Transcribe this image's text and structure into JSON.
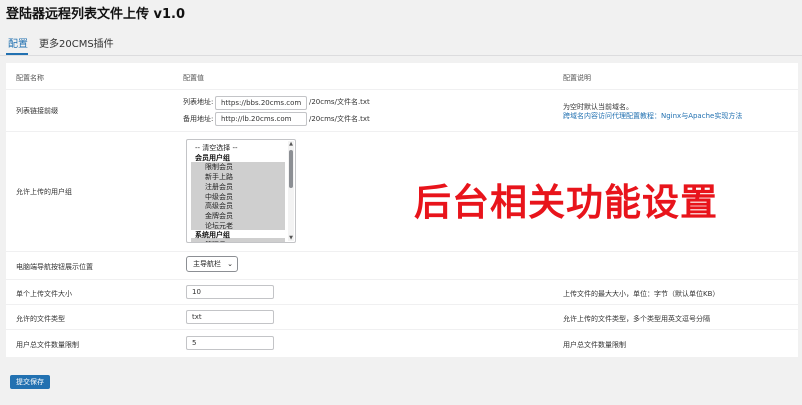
{
  "page": {
    "title": "登陆器远程列表文件上传 v1.0",
    "tabs": [
      {
        "label": "配置"
      },
      {
        "label": "更多20CMS插件"
      }
    ]
  },
  "table": {
    "headers": {
      "name": "配置名称",
      "value": "配置值",
      "desc": "配置说明"
    },
    "rows": {
      "prefix": {
        "label": "列表链接前缀",
        "list_addr_label": "列表地址:",
        "list_addr_value": "https://bbs.20cms.com",
        "list_addr_suffix": "/20cms/文件名.txt",
        "backup_addr_label": "备用地址:",
        "backup_addr_value": "http://lb.20cms.com",
        "backup_addr_suffix": "/20cms/文件名.txt",
        "desc_line1": "为空时默认当前域名。",
        "desc_link": "跨域名内容访问代理配置教程：Nginx与Apache实现方法"
      },
      "groups": {
        "label": "允许上传的用户组",
        "options": [
          {
            "text": "-- 清空选择 --",
            "type": "clear"
          },
          {
            "text": "会员用户组",
            "type": "group"
          },
          {
            "text": "限制会员",
            "type": "item"
          },
          {
            "text": "新手上路",
            "type": "item"
          },
          {
            "text": "注册会员",
            "type": "item"
          },
          {
            "text": "中级会员",
            "type": "item"
          },
          {
            "text": "高级会员",
            "type": "item"
          },
          {
            "text": "金牌会员",
            "type": "item"
          },
          {
            "text": "论坛元老",
            "type": "item"
          },
          {
            "text": "系统用户组",
            "type": "group"
          },
          {
            "text": "管理员",
            "type": "item"
          }
        ]
      },
      "nav": {
        "label": "电脑端导航按钮展示位置",
        "selected": "主导航栏"
      },
      "filesize": {
        "label": "单个上传文件大小",
        "value": "10",
        "desc": "上传文件的最大大小，单位：字节（默认单位KB）"
      },
      "filetype": {
        "label": "允许的文件类型",
        "value": "txt",
        "desc": "允许上传的文件类型，多个类型用英文逗号分隔"
      },
      "filecount": {
        "label": "用户总文件数量限制",
        "value": "5",
        "desc": "用户总文件数量限制"
      }
    }
  },
  "overlay_text": "后台相关功能设置",
  "submit_label": "提交保存",
  "colors": {
    "accent": "#2271b1",
    "overlay": "#e8141b"
  }
}
